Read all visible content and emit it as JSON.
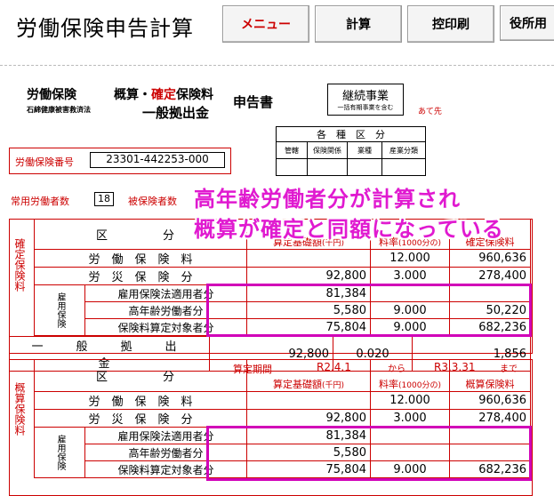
{
  "header": {
    "title": "労働保険申告計算",
    "buttons": [
      "メニュー",
      "計算",
      "控印刷",
      "役所用"
    ]
  },
  "form": {
    "title_left_1": "労働保険",
    "title_left_2": "石綿健康被害救済法",
    "title_mid_1a": "概算・",
    "title_mid_1b": "確定",
    "title_mid_1c": "保険料",
    "title_mid_2": "一般拠出金",
    "title_doc": "申告書",
    "continuous": "継続事業",
    "continuous_sub": "一括有期事業を含む",
    "addressee": "あて先",
    "class_header": "各　種　区　分",
    "class_cols": [
      "管轄",
      "保険関係",
      "業種",
      "産業分類"
    ],
    "number_label": "労働保険番号",
    "number_value": "23301-442253-000",
    "employees_label": "常用労働者数",
    "employees_value": "18",
    "insured_label": "被保険者数"
  },
  "overlay": {
    "line1": "高年齢労働者分が計算され",
    "line2": "概算が確定と同額になっている"
  },
  "kakutei": {
    "side": "確定保険料",
    "col_kubun": "区　　分",
    "col_base": "算定基礎額",
    "col_base_unit": "(千円)",
    "col_rate": "料率",
    "col_rate_unit": "(1000分の)",
    "col_amount": "確定保険料",
    "rows": [
      {
        "label": "労　働　保　険　料",
        "base": "",
        "rate": "12.000",
        "amount": "960,636"
      },
      {
        "label": "労　災　保　険　分",
        "base": "92,800",
        "rate": "3.000",
        "amount": "278,400"
      }
    ],
    "emp_side": "雇用保険",
    "emp_rows": [
      {
        "label": "雇用保険法適用者分",
        "base": "81,384",
        "rate": "",
        "amount": ""
      },
      {
        "label": "高年齢労働者分",
        "base": "5,580",
        "rate": "9.000",
        "amount": "50,220"
      },
      {
        "label": "保険料算定対象者分",
        "base": "75,804",
        "rate": "9.000",
        "amount": "682,236"
      }
    ],
    "general": {
      "label": "一　般　拠　出　金",
      "base": "92,800",
      "rate": "0.020",
      "amount": "1,856"
    }
  },
  "gaisan": {
    "side": "概算保険料",
    "period_label": "算定期間",
    "period_from": "R2.4.1",
    "period_kara": "から",
    "period_to": "R3.3.31",
    "period_made": "まで",
    "col_kubun": "区　　分",
    "col_base": "算定基礎額",
    "col_base_unit": "(千円)",
    "col_rate": "料率",
    "col_rate_unit": "(1000分の)",
    "col_amount": "概算保険料",
    "rows": [
      {
        "label": "労　働　保　険　料",
        "base": "",
        "rate": "12.000",
        "amount": "960,636"
      },
      {
        "label": "労　災　保　険　分",
        "base": "92,800",
        "rate": "3.000",
        "amount": "278,400"
      }
    ],
    "emp_side": "雇用保険",
    "emp_rows": [
      {
        "label": "雇用保険法適用者分",
        "base": "81,384",
        "rate": "",
        "amount": ""
      },
      {
        "label": "高年齢労働者分",
        "base": "5,580",
        "rate": "",
        "amount": ""
      },
      {
        "label": "保険料算定対象者分",
        "base": "75,804",
        "rate": "9.000",
        "amount": "682,236"
      }
    ]
  }
}
